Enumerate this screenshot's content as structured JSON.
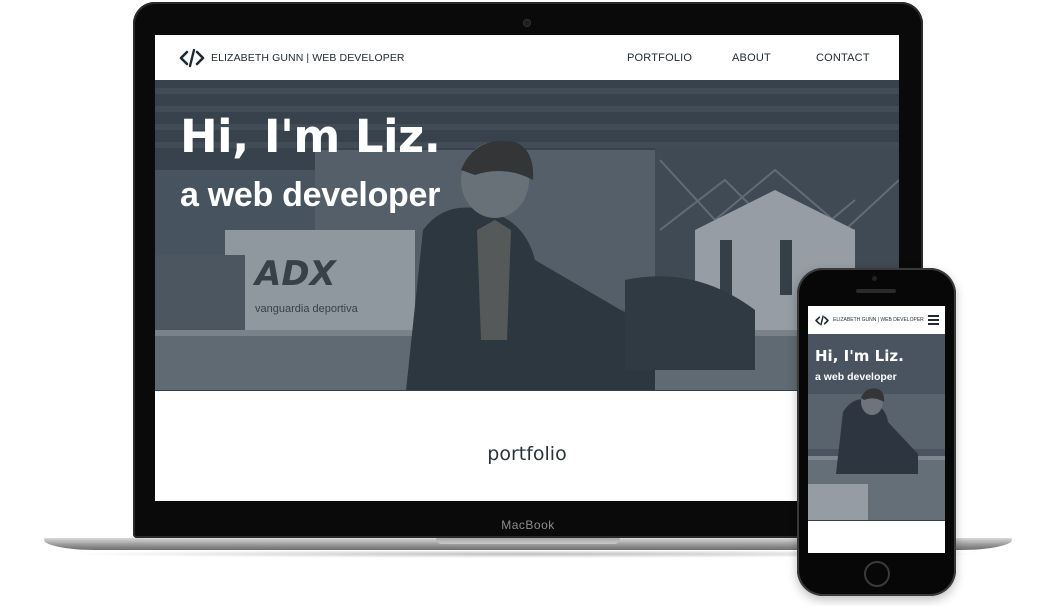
{
  "site": {
    "brand": "ELIZABETH GUNN | WEB DEVELOPER",
    "logo_icon": "code-brackets-icon",
    "nav": [
      {
        "label": "PORTFOLIO"
      },
      {
        "label": "ABOUT"
      },
      {
        "label": "CONTACT"
      }
    ]
  },
  "hero": {
    "title": "Hi, I'm Liz.",
    "subtitle": "a web developer",
    "image_sign_text": "ADX",
    "image_sign_tagline": "vanguardia deportiva"
  },
  "section": {
    "title": "portfolio"
  },
  "device": {
    "laptop_label": "MacBook"
  },
  "mobile": {
    "brand": "ELIZABETH GUNN | WEB DEVELOPER",
    "menu_icon": "hamburger-menu-icon",
    "title": "Hi, I'm Liz.",
    "subtitle": "a web developer"
  },
  "colors": {
    "text_dark": "#1f2a33",
    "hero_overlay": "#57616c",
    "background": "#ffffff"
  }
}
